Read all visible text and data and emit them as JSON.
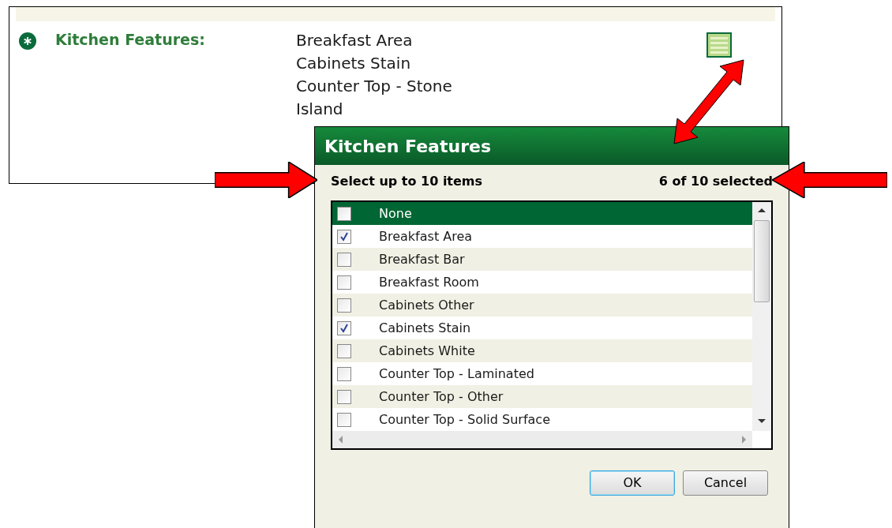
{
  "field": {
    "label": "Kitchen Features:",
    "values": [
      "Breakfast Area",
      "Cabinets Stain",
      "Counter Top - Stone",
      "Island"
    ]
  },
  "dialog": {
    "title": "Kitchen Features",
    "hint": "Select up to 10 items",
    "count": "6 of 10 selected",
    "items": [
      {
        "label": "None",
        "checked": false,
        "selected": true
      },
      {
        "label": "Breakfast Area",
        "checked": true,
        "selected": false
      },
      {
        "label": "Breakfast Bar",
        "checked": false,
        "selected": false
      },
      {
        "label": "Breakfast Room",
        "checked": false,
        "selected": false
      },
      {
        "label": "Cabinets Other",
        "checked": false,
        "selected": false
      },
      {
        "label": "Cabinets Stain",
        "checked": true,
        "selected": false
      },
      {
        "label": "Cabinets White",
        "checked": false,
        "selected": false
      },
      {
        "label": "Counter Top - Laminated",
        "checked": false,
        "selected": false
      },
      {
        "label": "Counter Top - Other",
        "checked": false,
        "selected": false
      },
      {
        "label": "Counter Top - Solid Surface",
        "checked": false,
        "selected": false
      }
    ],
    "buttons": [
      {
        "label": "OK",
        "default": true
      },
      {
        "label": "Cancel",
        "default": false
      }
    ]
  }
}
